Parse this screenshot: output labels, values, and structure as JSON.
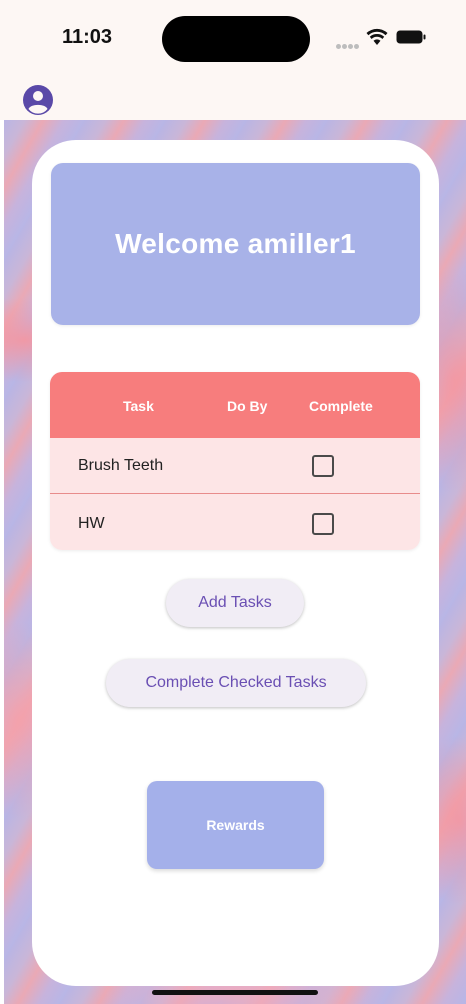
{
  "status_bar": {
    "time": "11:03"
  },
  "app_bar": {
    "account_icon": "account-circle-icon"
  },
  "welcome": {
    "text": "Welcome amiller1"
  },
  "task_table": {
    "columns": [
      "Task",
      "Do By",
      "Complete"
    ],
    "rows": [
      {
        "task": "Brush Teeth",
        "do_by": "",
        "complete": false
      },
      {
        "task": "HW",
        "do_by": "",
        "complete": false
      }
    ]
  },
  "buttons": {
    "add_tasks": "Add Tasks",
    "complete_checked": "Complete Checked Tasks",
    "rewards": "Rewards"
  },
  "colors": {
    "banner": "#a8b2e8",
    "table_header": "#f77d7d",
    "table_row": "#fde5e6",
    "pill_text": "#6a4fb3",
    "rewards_button": "#a4b0ea"
  }
}
